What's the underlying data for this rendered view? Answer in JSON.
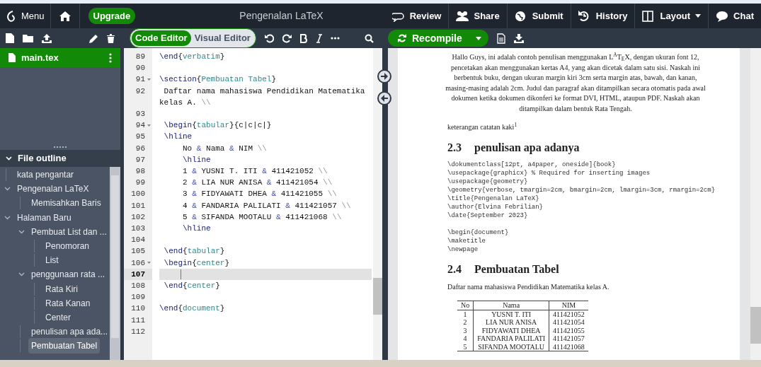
{
  "header": {
    "menu_label": "Menu",
    "upgrade_label": "Upgrade",
    "title": "Pengenalan LaTeX",
    "actions": [
      {
        "kind": "review",
        "label": "Review",
        "dropdown": false
      },
      {
        "kind": "share",
        "label": "Share",
        "dropdown": false
      },
      {
        "kind": "submit",
        "label": "Submit",
        "dropdown": false
      },
      {
        "kind": "history",
        "label": "History",
        "dropdown": false
      },
      {
        "kind": "layout",
        "label": "Layout",
        "dropdown": true
      },
      {
        "kind": "chat",
        "label": "Chat",
        "dropdown": false
      }
    ]
  },
  "file_tree": [
    {
      "name": "main.tex",
      "selected": true
    }
  ],
  "file_outline": {
    "title": "File outline",
    "expanded": true,
    "items": [
      {
        "label": "kata pengantar",
        "selected": false
      },
      {
        "label": "Pengenalan LaTeX",
        "selected": false,
        "expanded": true,
        "children": [
          {
            "label": "Memisahkan Baris",
            "selected": false
          }
        ]
      },
      {
        "label": "Halaman Baru",
        "selected": false,
        "expanded": true,
        "children": [
          {
            "label": "Pembuat List dan ...",
            "selected": false,
            "expanded": true,
            "children": [
              {
                "label": "Penomoran",
                "selected": false
              },
              {
                "label": "List",
                "selected": false
              }
            ]
          },
          {
            "label": "penggunaan rata ...",
            "selected": false,
            "expanded": true,
            "children": [
              {
                "label": "Rata Kiri",
                "selected": false
              },
              {
                "label": "Rata Kanan",
                "selected": false
              },
              {
                "label": "Center",
                "selected": false
              }
            ]
          },
          {
            "label": "penulisan apa ada...",
            "selected": false
          },
          {
            "label": "Pembuatan Tabel",
            "selected": true
          }
        ]
      }
    ]
  },
  "editor": {
    "modes": [
      {
        "label": "Code Editor",
        "selected": true
      },
      {
        "label": "Visual Editor",
        "selected": false
      }
    ],
    "lines": [
      {
        "number": "89",
        "text": "\\end{verbatim}",
        "fold": false,
        "current": false
      },
      {
        "number": "90",
        "fold": false,
        "current": false
      },
      {
        "number": "91",
        "text": "\\section{Pembuatan Tabel}",
        "fold": true,
        "current": false
      },
      {
        "number": "92",
        "text": " Daftar nama mahasiswa Pendidikan Matematika kelas A. \\\\",
        "fold": false,
        "current": false
      },
      {
        "number": "93",
        "fold": false,
        "current": false
      },
      {
        "number": "94",
        "text": " \\begin{tabular}{c|c|c|}",
        "fold": true,
        "current": false
      },
      {
        "number": "95",
        "text": " \\hline",
        "fold": false,
        "current": false
      },
      {
        "number": "96",
        "text": "     No & Nama & NIM \\\\",
        "fold": false,
        "current": false
      },
      {
        "number": "97",
        "text": "     \\hline",
        "fold": false,
        "current": false
      },
      {
        "number": "98",
        "text": "     1 & YUSNI T. ITI & 411421052 \\\\",
        "fold": false,
        "current": false
      },
      {
        "number": "99",
        "text": "     2 & LIA NUR ANISA & 411421054 \\\\",
        "fold": false,
        "current": false
      },
      {
        "number": "100",
        "text": "     3 & FIDYAWATI DHEA & 411421055 \\\\",
        "fold": false,
        "current": false
      },
      {
        "number": "101",
        "text": "     4 & FANDARIA PALILATI & 411421057 \\\\",
        "fold": false,
        "current": false
      },
      {
        "number": "102",
        "text": "     5 & SIFANDA MOOTALU & 411421068 \\\\",
        "fold": false,
        "current": false
      },
      {
        "number": "103",
        "text": "     \\hline",
        "fold": false,
        "current": false
      },
      {
        "number": "104",
        "fold": false,
        "current": false
      },
      {
        "number": "105",
        "text": " \\end{tabular}",
        "fold": false,
        "current": false
      },
      {
        "number": "106",
        "text": " \\begin{center}",
        "fold": true,
        "current": false
      },
      {
        "number": "107",
        "fold": false,
        "current": true
      },
      {
        "number": "108",
        "text": " \\end{center}",
        "fold": false,
        "current": false
      },
      {
        "number": "109",
        "fold": false,
        "current": false
      },
      {
        "number": "110",
        "text": "\\end{document}",
        "fold": false,
        "current": false
      },
      {
        "number": "111",
        "fold": false,
        "current": false
      },
      {
        "number": "112",
        "fold": false,
        "current": false
      }
    ]
  },
  "preview_toolbar": {
    "recompile_label": "Recompile"
  },
  "preview": {
    "blocks": [
      {
        "kind": "centered",
        "text": "Hallo Guys, ini adalah contoh penulisan menggunakan L$^{A}$T$_{E}$X, dengan ukuran font 12, pencetakan akan menggunakan kertas A4, yang akan dicetak dalam satu sisi. Naskah ini berbentuk buku, dengan ukuran margin kiri 3cm serta margin atas, bawah, dan kanan, masing-masing adalah 2cm. Judul dan paragraf akan ditampilkan secara otomatis pada awal dokumen ketika dokumen dikonferi ke format DVI, HTML, ataupun PDF. Naskah akan ditampilkan dalam bentuk Rata Tengah."
      },
      {
        "kind": "paragraph",
        "text": "keterangan catatan kaki$^{1}$"
      },
      {
        "kind": "heading",
        "number": "2.3",
        "title": "penulisan apa adanya"
      },
      {
        "kind": "code",
        "lines": [
          "\\dokumentclass[12pt, a4paper, oneside]{book}",
          "\\usepackage{graphicx} % Required for inserting images",
          "\\usepackage{geometry}",
          "\\geometry{verbose, tmargin=2cm, bmargin=2cm, lmargin=3cm, rmargin=2cm}",
          "\\title{Pengenalan LaTeX}",
          "\\author{Elvina Febrilian}",
          "\\date{September 2023}"
        ]
      },
      {
        "kind": "code",
        "lines": [
          "\\begin{document}",
          "\\maketitle",
          "\\newpage"
        ]
      },
      {
        "kind": "heading",
        "number": "2.4",
        "title": "Pembuatan Tabel"
      },
      {
        "kind": "paragraph",
        "text": "Daftar nama mahasiswa Pendidikan Matematika kelas A."
      },
      {
        "kind": "table",
        "columns": [
          "No",
          "Nama",
          "NIM"
        ],
        "rows": [
          [
            "1",
            "YUSNI T. ITI",
            "411421052"
          ],
          [
            "2",
            "LIA NUR ANISA",
            "411421054"
          ],
          [
            "3",
            "FIDYAWATI DHEA",
            "411421055"
          ],
          [
            "4",
            "FANDARIA PALILATI",
            "411421057"
          ],
          [
            "5",
            "SIFANDA MOOTALU",
            "411421068"
          ]
        ]
      }
    ]
  }
}
